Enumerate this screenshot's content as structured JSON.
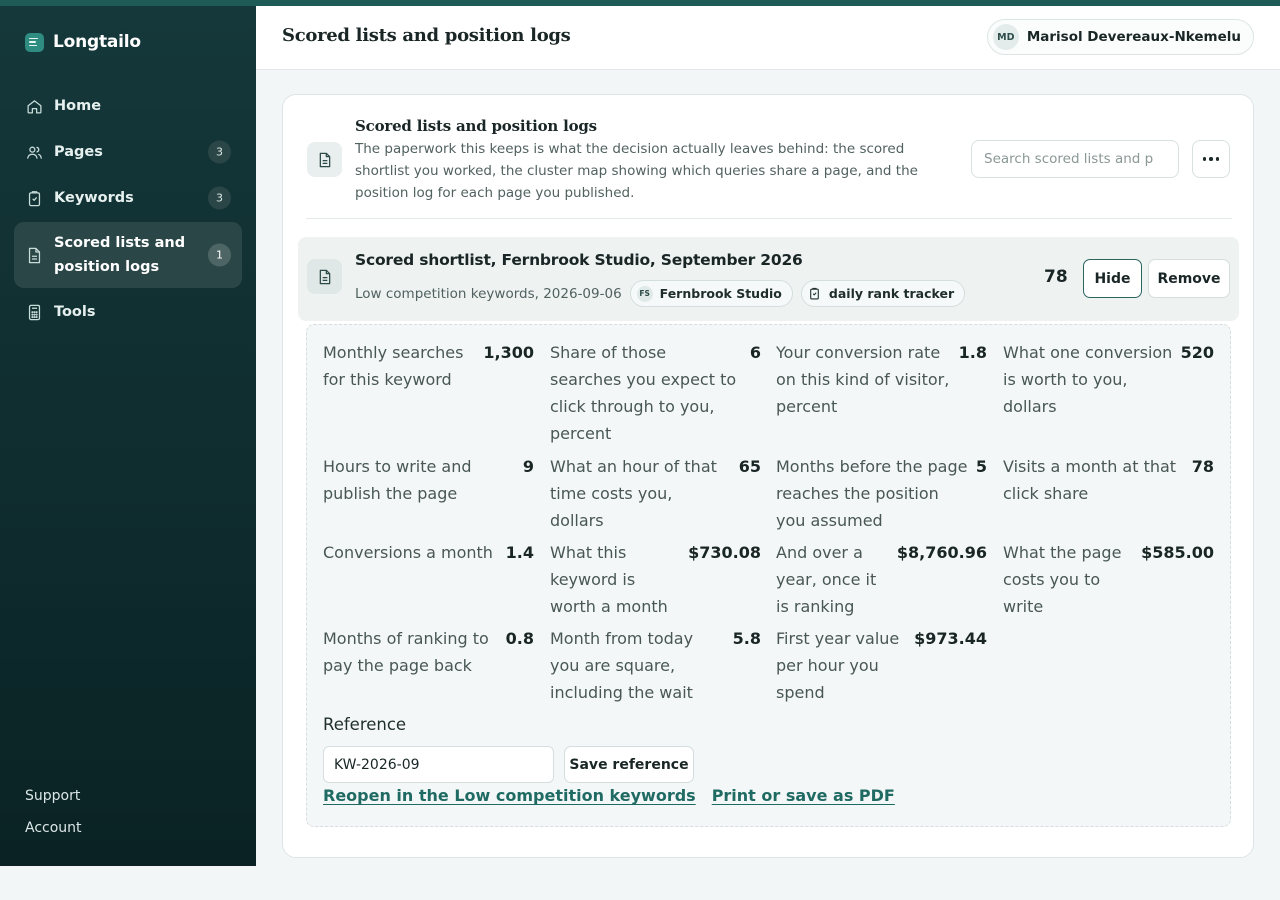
{
  "app": {
    "name": "Longtailo"
  },
  "sidebar": {
    "items": [
      {
        "label": "Home",
        "icon": "home-icon"
      },
      {
        "label": "Pages",
        "icon": "users-icon",
        "count": "3"
      },
      {
        "label": "Keywords",
        "icon": "clipboard-icon",
        "count": "3"
      },
      {
        "label": "Scored lists and position logs",
        "icon": "document-icon",
        "count": "1",
        "active": true
      },
      {
        "label": "Tools",
        "icon": "calculator-icon"
      }
    ],
    "support": "Support",
    "account": "Account"
  },
  "header": {
    "title": "Scored lists and position logs",
    "user_initials": "MD",
    "user_name": "Marisol Devereaux-Nkemelu"
  },
  "section": {
    "title": "Scored lists and position logs",
    "description": "The paperwork this keeps is what the decision actually leaves behind: the scored shortlist you worked, the cluster map showing which queries share a page, and the position log for each page you published.",
    "search_placeholder": "Search scored lists and p"
  },
  "entry": {
    "title": "Scored shortlist, Fernbrook Studio, September 2026",
    "meta": "Low competition keywords, 2026-09-06",
    "client_initials": "FS",
    "client_name": "Fernbrook Studio",
    "tool_tag": "daily rank tracker",
    "score": "78",
    "hide_label": "Hide",
    "remove_label": "Remove",
    "fields": [
      {
        "label": "Monthly searches for this keyword",
        "value": "1,300"
      },
      {
        "label": "Share of those searches you expect to click through to you, percent",
        "value": "6"
      },
      {
        "label": "Your conversion rate on this kind of visitor, percent",
        "value": "1.8"
      },
      {
        "label": "What one conversion is worth to you, dollars",
        "value": "520"
      },
      {
        "label": "Hours to write and publish the page",
        "value": "9"
      },
      {
        "label": "What an hour of that time costs you, dollars",
        "value": "65"
      },
      {
        "label": "Months before the page reaches the position you assumed",
        "value": "5"
      },
      {
        "label": "Visits a month at that click share",
        "value": "78"
      },
      {
        "label": "Conversions a month",
        "value": "1.4"
      },
      {
        "label": "What this keyword is worth a month",
        "value": "$730.08"
      },
      {
        "label": "And over a year, once it is ranking",
        "value": "$8,760.96"
      },
      {
        "label": "What the page costs you to write",
        "value": "$585.00"
      },
      {
        "label": "Months of ranking to pay the page back",
        "value": "0.8"
      },
      {
        "label": "Month from today you are square, including the wait",
        "value": "5.8"
      },
      {
        "label": "First year value per hour you spend",
        "value": "$973.44"
      }
    ],
    "reference_label": "Reference",
    "reference_value": "KW-2026-09",
    "save_reference_label": "Save reference",
    "reopen_link": "Reopen in the Low competition keywords",
    "print_link": "Print or save as PDF"
  },
  "colors": {
    "sidebar_top": "#15383a",
    "sidebar_bottom": "#0a2224",
    "accent": "#1f6a62",
    "brand_mark": "#2f8c80"
  }
}
